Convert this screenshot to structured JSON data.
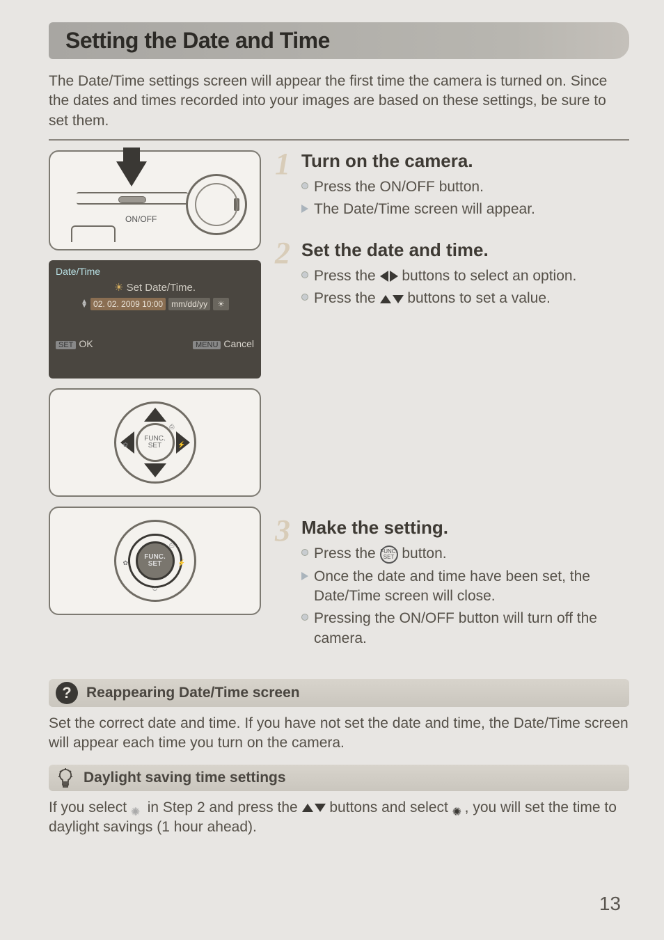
{
  "title": "Setting the Date and Time",
  "intro": "The Date/Time settings screen will appear the first time the camera is turned on. Since the dates and times recorded into your images are based on these settings, be sure to set them.",
  "fig1": {
    "onoff": "ON/OFF"
  },
  "fig2": {
    "title": "Date/Time",
    "subtitle": "Set Date/Time.",
    "date": "02. 02. 2009 10:00",
    "format": "mm/dd/yy",
    "ok_btn": "SET",
    "ok": "OK",
    "cancel_btn": "MENU",
    "cancel": "Cancel"
  },
  "dpad": {
    "func": "FUNC.",
    "set": "SET"
  },
  "steps": [
    {
      "num": "1",
      "heading": "Turn on the camera.",
      "items": [
        {
          "kind": "dot",
          "text": "Press the ON/OFF button."
        },
        {
          "kind": "arrow",
          "text": "The Date/Time screen will appear."
        }
      ]
    },
    {
      "num": "2",
      "heading": "Set the date and time.",
      "items": [
        {
          "kind": "dot",
          "pre": "Press the ",
          "glyph": "lr",
          "post": " buttons to select an option."
        },
        {
          "kind": "dot",
          "pre": "Press the ",
          "glyph": "ud",
          "post": " buttons to set a value."
        }
      ]
    },
    {
      "num": "3",
      "heading": "Make the setting.",
      "items": [
        {
          "kind": "dot",
          "pre": "Press the ",
          "glyph": "func",
          "post": " button."
        },
        {
          "kind": "arrow",
          "text": "Once the date and time have been set, the Date/Time screen will close."
        },
        {
          "kind": "dot",
          "text": "Pressing the ON/OFF button will turn off the camera."
        }
      ]
    }
  ],
  "callout1": {
    "title": "Reappearing Date/Time screen",
    "body": "Set the correct date and time. If you have not set the date and time, the Date/Time screen will appear each time you turn on the camera."
  },
  "callout2": {
    "title": "Daylight saving time settings",
    "pre": "If you select ",
    "mid1": " in Step 2 and press the ",
    "mid2": " buttons and select ",
    "post": ", you will set the time to daylight savings (1 hour ahead)."
  },
  "page": "13"
}
